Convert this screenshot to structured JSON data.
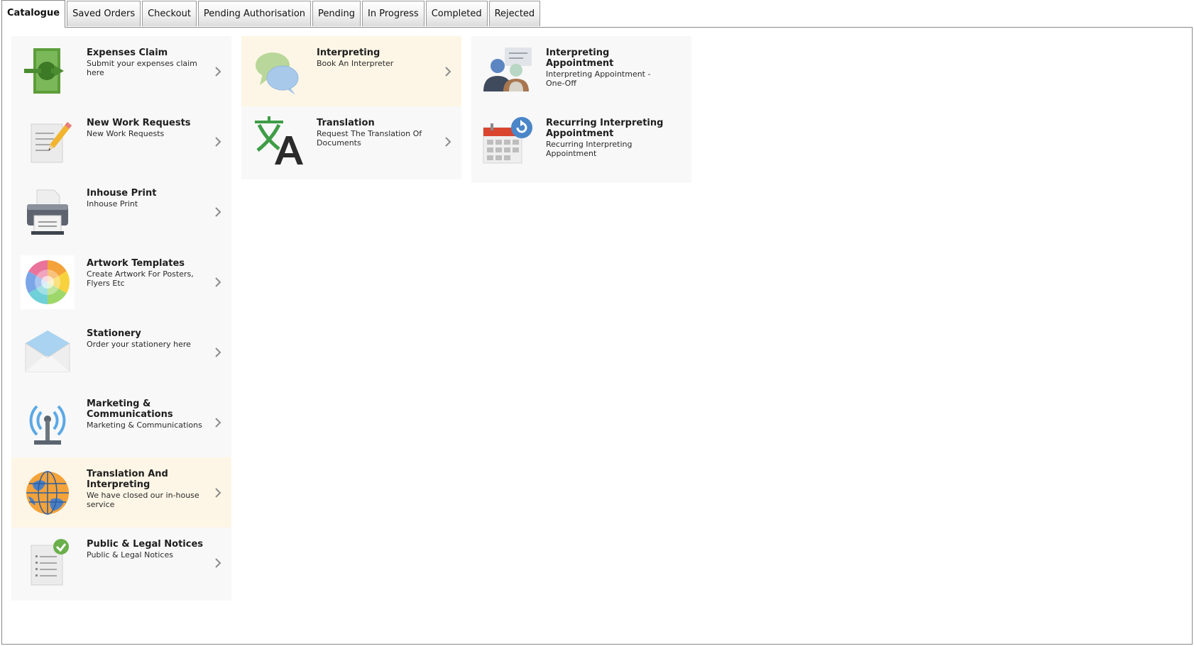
{
  "tabs": [
    {
      "key": "catalogue",
      "label": "Catalogue",
      "active": true
    },
    {
      "key": "saved-orders",
      "label": "Saved Orders",
      "active": false
    },
    {
      "key": "checkout",
      "label": "Checkout",
      "active": false
    },
    {
      "key": "pending-authorisation",
      "label": "Pending Authorisation",
      "active": false
    },
    {
      "key": "pending",
      "label": "Pending",
      "active": false
    },
    {
      "key": "in-progress",
      "label": "In Progress",
      "active": false
    },
    {
      "key": "completed",
      "label": "Completed",
      "active": false
    },
    {
      "key": "rejected",
      "label": "Rejected",
      "active": false
    }
  ],
  "colors": {
    "highlight_card": "#fdf6e6",
    "card": "#f8f8f8",
    "chevron": "#8c8c8c",
    "money_green": "#5d9d3a",
    "translation_green": "#3f9d47",
    "antenna_blue": "#5aa9e6",
    "calendar_red": "#d9452e"
  },
  "catalogue": {
    "col1": [
      {
        "title": "Expenses Claim",
        "description": "Submit your expenses claim here",
        "icon": "money-transfer-icon",
        "highlight": false
      },
      {
        "title": "New Work Requests",
        "description": "New Work Requests",
        "icon": "document-pencil-icon",
        "highlight": false
      },
      {
        "title": "Inhouse Print",
        "description": "Inhouse Print",
        "icon": "printer-icon",
        "highlight": false
      },
      {
        "title": "Artwork Templates",
        "description": "Create Artwork For Posters, Flyers Etc",
        "icon": "color-wheel-icon",
        "highlight": false
      },
      {
        "title": "Stationery",
        "description": "Order your stationery here",
        "icon": "envelope-icon",
        "highlight": false
      },
      {
        "title": "Marketing & Communications",
        "description": "Marketing & Communications",
        "icon": "antenna-icon",
        "highlight": false
      },
      {
        "title": "Translation And Interpreting",
        "description": "We have closed our in-house service",
        "icon": "globe-icon",
        "highlight": true
      },
      {
        "title": "Public & Legal Notices",
        "description": "Public & Legal Notices",
        "icon": "checklist-icon",
        "highlight": false
      }
    ],
    "col2": [
      {
        "title": "Interpreting",
        "description": "Book An Interpreter",
        "icon": "speech-bubbles-icon",
        "highlight": true
      },
      {
        "title": "Translation",
        "description": "Request The Translation Of Documents",
        "icon": "translate-icon",
        "highlight": false
      }
    ],
    "col3": [
      {
        "title": "Interpreting Appointment",
        "description": "Interpreting Appointment - One-Off",
        "icon": "conversation-people-icon",
        "highlight": false
      },
      {
        "title": "Recurring Interpreting Appointment",
        "description": "Recurring Interpreting Appointment",
        "icon": "recurring-calendar-icon",
        "highlight": false
      }
    ]
  }
}
